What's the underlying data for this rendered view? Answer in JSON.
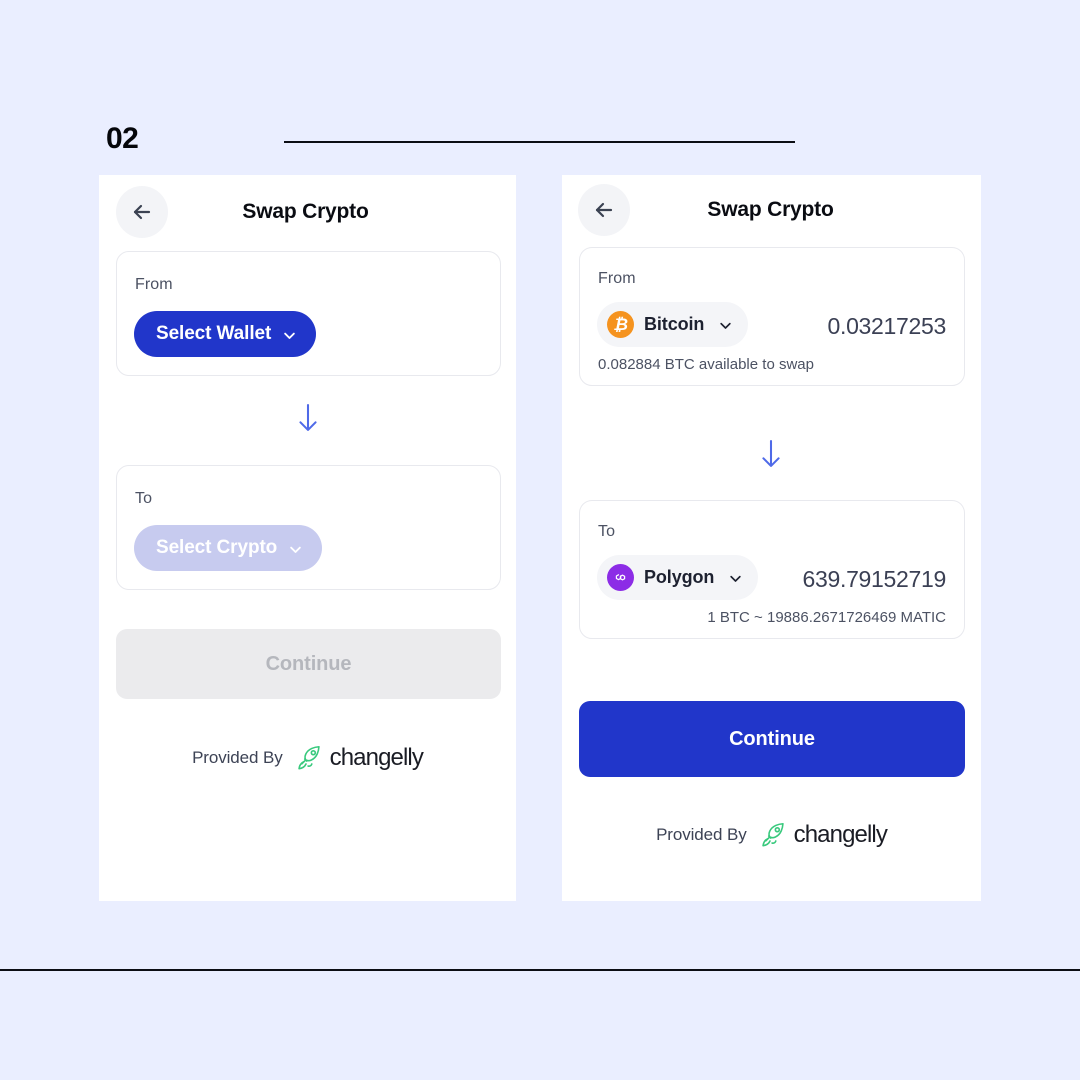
{
  "slide": {
    "step_number": "02"
  },
  "screens": [
    {
      "id": "empty-state",
      "title": "Swap Crypto",
      "back_icon": "arrow-left-icon",
      "from": {
        "label": "From",
        "selector_text": "Select Wallet",
        "selector_state": "enabled",
        "chevron_icon": "chevron-down-icon"
      },
      "swap_icon": "arrow-down-icon",
      "to": {
        "label": "To",
        "selector_text": "Select Crypto",
        "selector_state": "disabled",
        "chevron_icon": "chevron-down-icon"
      },
      "continue_label": "Continue",
      "continue_state": "disabled",
      "footer": {
        "provided_by": "Provided By",
        "brand": "changelly",
        "brand_icon": "rocket-icon"
      }
    },
    {
      "id": "filled-state",
      "title": "Swap Crypto",
      "back_icon": "arrow-left-icon",
      "from": {
        "label": "From",
        "asset_name": "Bitcoin",
        "asset_icon": "bitcoin-icon",
        "asset_symbol": "₿",
        "chevron_icon": "chevron-down-icon",
        "amount": "0.03217253",
        "helper": "0.082884 BTC available to swap"
      },
      "swap_icon": "arrow-down-icon",
      "to": {
        "label": "To",
        "asset_name": "Polygon",
        "asset_icon": "polygon-icon",
        "chevron_icon": "chevron-down-icon",
        "amount": "639.79152719",
        "helper": "1 BTC ~ 19886.2671726469 MATIC"
      },
      "continue_label": "Continue",
      "continue_state": "enabled",
      "footer": {
        "provided_by": "Provided By",
        "brand": "changelly",
        "brand_icon": "rocket-icon"
      }
    }
  ],
  "colors": {
    "page_background": "#eaeeff",
    "primary": "#2136ca",
    "primary_muted": "#c7cbef",
    "bitcoin_orange": "#f5931f",
    "polygon_purple": "#8c2ce6",
    "changelly_green": "#39c97d",
    "disabled_button": "#ebebed",
    "rule": "#0b0d14"
  }
}
